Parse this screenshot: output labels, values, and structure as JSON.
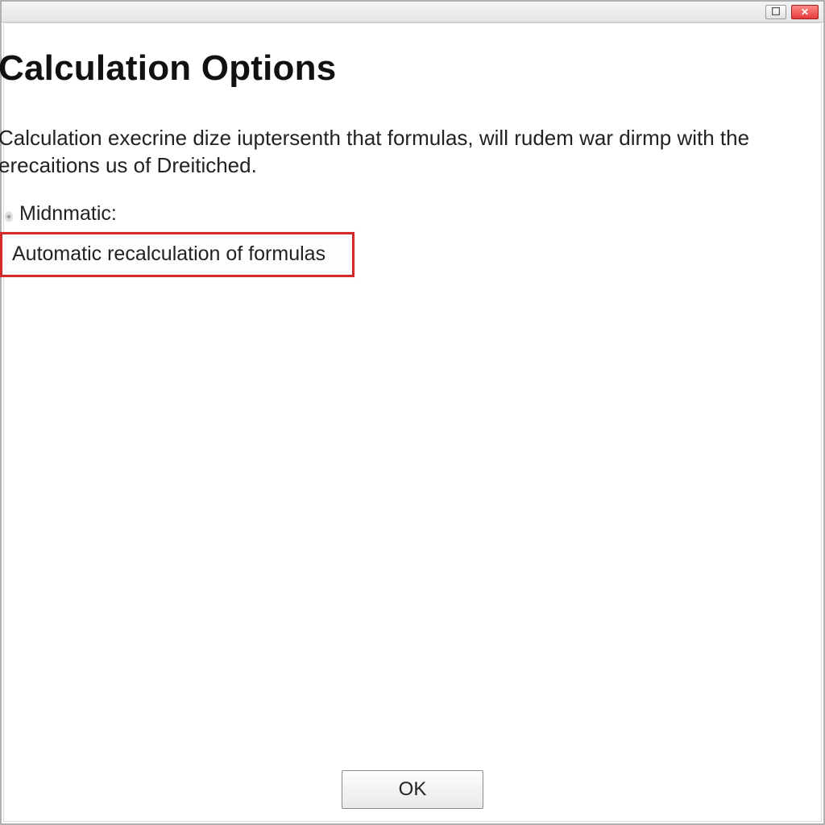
{
  "window": {
    "page_title": "Calculation Options",
    "description": "Calculation execrine dize iuptersenth that formulas, will rudem war dirmp with the erecaitions us of Dreitiched.",
    "section_label": "Midnmatic:",
    "option_selected": "Automatic recalculation of formulas",
    "ok_label": "OK"
  },
  "titlebar": {
    "maximize_tooltip": "Maximize",
    "close_tooltip": "Close"
  },
  "highlight_color": "#d62a2a"
}
